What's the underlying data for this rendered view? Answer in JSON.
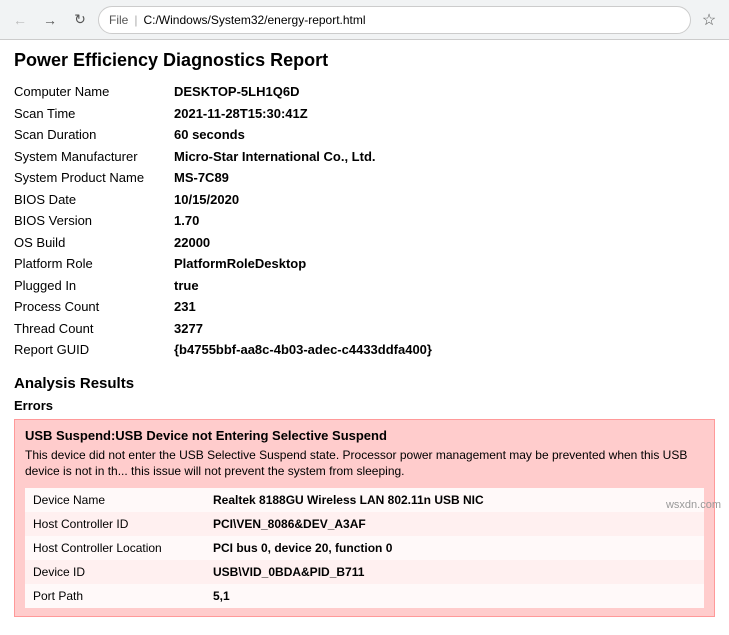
{
  "browser": {
    "back_disabled": true,
    "forward_disabled": true,
    "scheme": "File",
    "path": "C:/Windows/System32/energy-report.html",
    "back_label": "←",
    "forward_label": "→",
    "refresh_label": "↻",
    "star_label": "☆"
  },
  "report": {
    "title": "Power Efficiency Diagnostics Report",
    "fields": [
      {
        "label": "Computer Name",
        "value": "DESKTOP-5LH1Q6D"
      },
      {
        "label": "Scan Time",
        "value": "2021-11-28T15:30:41Z"
      },
      {
        "label": "Scan Duration",
        "value": "60 seconds"
      },
      {
        "label": "System Manufacturer",
        "value": "Micro-Star International Co., Ltd."
      },
      {
        "label": "System Product Name",
        "value": "MS-7C89"
      },
      {
        "label": "BIOS Date",
        "value": "10/15/2020"
      },
      {
        "label": "BIOS Version",
        "value": "1.70"
      },
      {
        "label": "OS Build",
        "value": "22000"
      },
      {
        "label": "Platform Role",
        "value": "PlatformRoleDesktop"
      },
      {
        "label": "Plugged In",
        "value": "true"
      },
      {
        "label": "Process Count",
        "value": "231"
      },
      {
        "label": "Thread Count",
        "value": "3277"
      },
      {
        "label": "Report GUID",
        "value": "{b4755bbf-aa8c-4b03-adec-c4433ddfa400}"
      }
    ]
  },
  "analysis": {
    "section_title": "Analysis Results",
    "subsection_errors": "Errors",
    "errors": [
      {
        "heading": "USB Suspend:USB Device not Entering Selective Suspend",
        "description": "This device did not enter the USB Selective Suspend state. Processor power management may be prevented when this USB device is not in th... this issue will not prevent the system from sleeping.",
        "details": [
          {
            "label": "Device Name",
            "value": "Realtek 8188GU Wireless LAN 802.11n USB NIC"
          },
          {
            "label": "Host Controller ID",
            "value": "PCI\\VEN_8086&DEV_A3AF"
          },
          {
            "label": "Host Controller Location",
            "value": "PCI bus 0, device 20, function 0"
          },
          {
            "label": "Device ID",
            "value": "USB\\VID_0BDA&PID_B711"
          },
          {
            "label": "Port Path",
            "value": "5,1"
          }
        ]
      }
    ]
  },
  "watermark": "wsxdn.com"
}
